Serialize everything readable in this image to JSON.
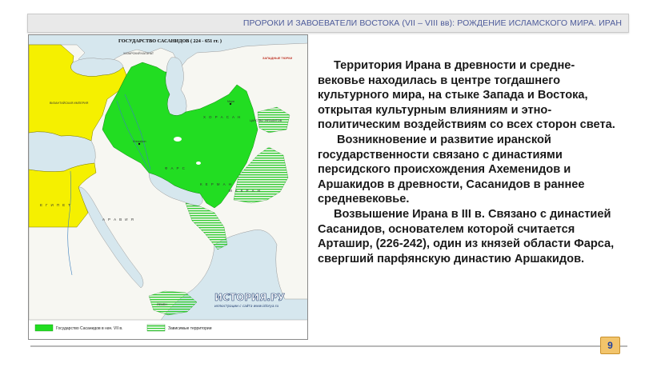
{
  "header": {
    "title": "ПРОРОКИ И ЗАВОЕВАТЕЛИ ВОСТОКА (VII – VIII вв): РОЖДЕНИЕ ИСЛАМСКОГО МИРА. ИРАН"
  },
  "map": {
    "title": "ГОСУДАРСТВО САСАНИДОВ ( 224 - 651 гг. )",
    "labels": {
      "khazar": "ХАЗАРСКИЙ КАГАНАТ",
      "western_turks": "ЗАПАДНЫЕ ТЮРКИ",
      "byzantine": "ВИЗАНТИЙСКАЯ ИМПЕРИЯ",
      "egypt": "Е Г И П Е Т",
      "arabia": "А Р А В И Я",
      "khorasan": "Х О Р А С А Н",
      "fars": "Ф А Р С",
      "kerman": "К Е Р М А Н",
      "makran": "М А К Р А Н",
      "yemen": "ЙЕМЕН",
      "hephthalites": "ЦАРСТВО ЭФТАЛИТОВ",
      "ctesiphon": "Ктесифон",
      "merv": "Мерв"
    },
    "legend": {
      "sasanid": "Государство Сасанидов в нач. VII в.",
      "contested": "Зависимые территории"
    },
    "watermark": {
      "main": "ИСТОРИЯ.РУ",
      "sub": "иллюстрации с сайта www.istorya.ru"
    },
    "colors": {
      "sasanid": "#22dd22",
      "byzantine": "#f5f000",
      "contested_stripe": "#33cc33",
      "water": "#d6e7ee"
    }
  },
  "body": {
    "p1": "Территория Ирана в древности и средне-вековье находилась в центре тогдашнего культурного мира, на стыке Запада и Востока, открытая культурным влияниям и этно-политическим воздействиям со всех сторон света.",
    "p2": "Возникновение и развитие иранской государственности связано с династиями персидского происхождения Ахеменидов и Аршакидов в древности, Сасанидов в раннее средневековье.",
    "p3": "Возвышение Ирана в III в. Связано с династией Сасанидов, основателем которой считается Арташир, (226-242), один из князей области Фарса, свергший парфянскую династию Аршакидов."
  },
  "footer": {
    "page_number": "9"
  }
}
